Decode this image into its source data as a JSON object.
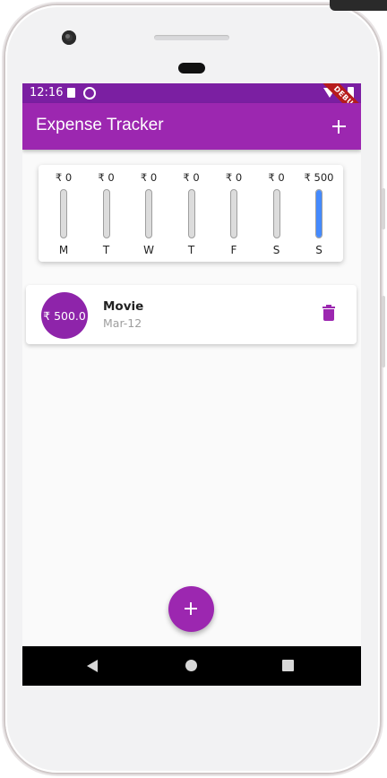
{
  "colors": {
    "primary": "#9c27b0",
    "status_bar": "#7b1fa2",
    "bar_fill": "#448aff",
    "avatar": "#8e24aa"
  },
  "status_bar": {
    "time": "12:16",
    "debug_label": "DEBUG"
  },
  "app_bar": {
    "title": "Expense Tracker",
    "action_icon": "add-icon"
  },
  "chart": {
    "days": [
      {
        "day": "M",
        "amount": "₹ 0"
      },
      {
        "day": "T",
        "amount": "₹ 0"
      },
      {
        "day": "W",
        "amount": "₹ 0"
      },
      {
        "day": "T",
        "amount": "₹ 0"
      },
      {
        "day": "F",
        "amount": "₹ 0"
      },
      {
        "day": "S",
        "amount": "₹ 0"
      },
      {
        "day": "S",
        "amount": "₹ 500"
      }
    ]
  },
  "chart_data": {
    "type": "bar",
    "categories": [
      "M",
      "T",
      "W",
      "T",
      "F",
      "S",
      "S"
    ],
    "values": [
      0,
      0,
      0,
      0,
      0,
      0,
      500
    ]
  },
  "transactions": [
    {
      "amount": "₹ 500.0",
      "title": "Movie",
      "date": "Mar-12",
      "delete_icon": "trash-icon"
    }
  ],
  "fab": {
    "icon": "add-icon"
  },
  "nav": {
    "back": "back-icon",
    "home": "home-icon",
    "recents": "recents-icon"
  }
}
